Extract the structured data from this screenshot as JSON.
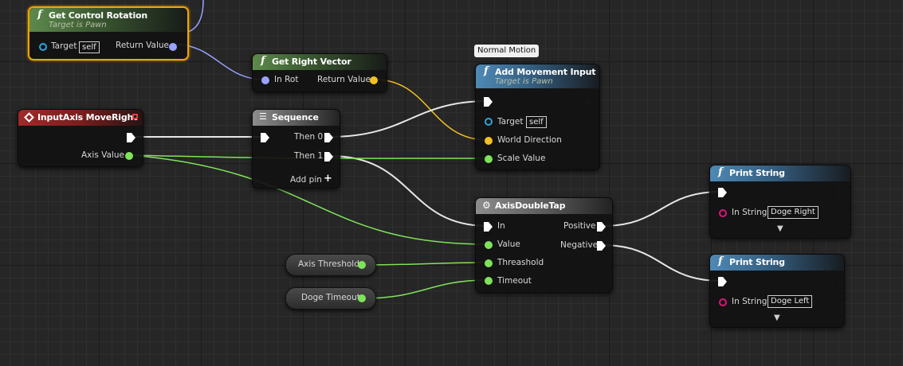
{
  "nodes": {
    "get_control_rotation": {
      "title": "Get Control Rotation",
      "subtitle": "Target is Pawn",
      "target_label": "Target",
      "target_value": "self",
      "return_label": "Return Value"
    },
    "get_right_vector": {
      "title": "Get Right Vector",
      "in_label": "In Rot",
      "return_label": "Return Value"
    },
    "add_movement_input": {
      "comment": "Normal Motion",
      "title": "Add Movement Input",
      "subtitle": "Target is Pawn",
      "target_label": "Target",
      "target_value": "self",
      "direction_label": "World Direction",
      "scale_label": "Scale Value"
    },
    "input_axis": {
      "title": "InputAxis MoveRight",
      "axis_label": "Axis Value"
    },
    "sequence": {
      "title": "Sequence",
      "then0": "Then 0",
      "then1": "Then 1",
      "add_pin": "Add pin"
    },
    "axis_double_tap": {
      "title": "AxisDoubleTap",
      "in_label": "In",
      "value_label": "Value",
      "threshold_label": "Threashold",
      "timeout_label": "Timeout",
      "positive_label": "Positive",
      "negative_label": "Negative"
    },
    "axis_threshold": {
      "label": "Axis Threshold"
    },
    "doge_timeout": {
      "label": "Doge Timeout"
    },
    "print_string_1": {
      "title": "Print String",
      "in_label": "In String",
      "value": "Doge Right"
    },
    "print_string_2": {
      "title": "Print String",
      "in_label": "In String",
      "value": "Doge Left"
    }
  },
  "icons": {
    "function": "f",
    "add_pin": "+",
    "expand": "▼"
  },
  "colors": {
    "exec_wire": "#e6e6e6",
    "float_wire": "#7fe35a",
    "vector_wire": "#f2c021",
    "rotator_wire": "#9aa3ff",
    "selection": "#f0a400"
  }
}
